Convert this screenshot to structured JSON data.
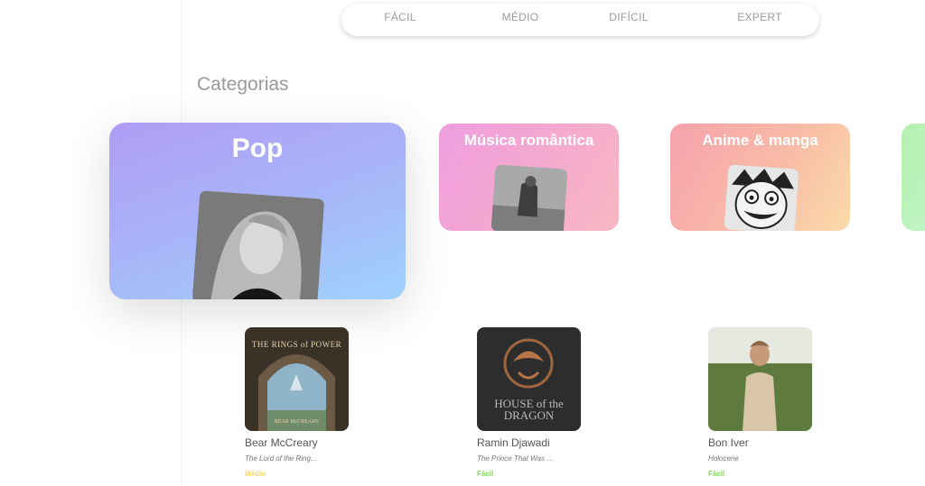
{
  "difficulty": {
    "items": [
      {
        "label": "FÁCIL"
      },
      {
        "label": "MÉDIO"
      },
      {
        "label": "DIFÍCIL"
      },
      {
        "label": "EXPERT"
      }
    ]
  },
  "categories": {
    "title": "Categorias",
    "cards": [
      {
        "title": "Pop",
        "image": "singer-portrait"
      },
      {
        "title": "Música romântica",
        "image": "couple-photo"
      },
      {
        "title": "Anime & manga",
        "image": "manga-character"
      },
      {
        "title": "",
        "image": ""
      }
    ]
  },
  "albums": [
    {
      "artist": "Bear McCreary",
      "track": "The Lord of the Ring...",
      "difficulty": "Médio",
      "difficulty_color": "#f5d76e",
      "cover": {
        "line1": "THE RINGS of POWER",
        "line2": "BEAR McCREARY"
      }
    },
    {
      "artist": "Ramin Djawadi",
      "track": "The Prince That Was ...",
      "difficulty": "Fácil",
      "difficulty_color": "#7ed957",
      "cover": {
        "line1": "HOUSE of the DRAGON",
        "line2": ""
      }
    },
    {
      "artist": "Bon Iver",
      "track": "Holocene",
      "difficulty": "Fácil",
      "difficulty_color": "#7ed957",
      "cover": {
        "line1": "",
        "line2": ""
      }
    }
  ]
}
